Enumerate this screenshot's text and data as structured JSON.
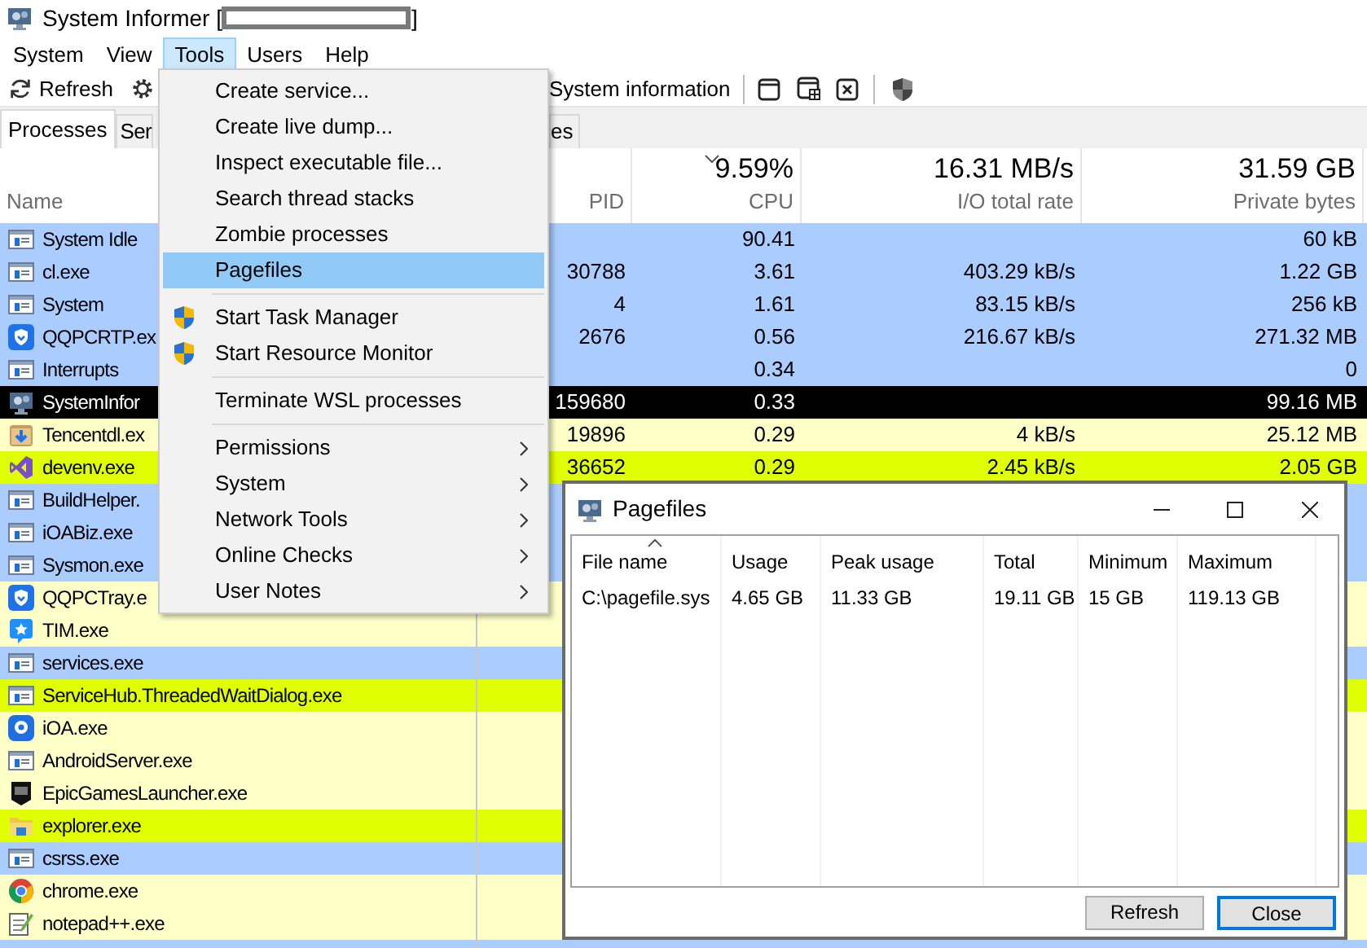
{
  "window": {
    "title_prefix": "System Informer [",
    "title_suffix": "]"
  },
  "menu_bar": [
    {
      "label": "System",
      "selected": false
    },
    {
      "label": "View",
      "selected": false
    },
    {
      "label": "Tools",
      "selected": true
    },
    {
      "label": "Users",
      "selected": false
    },
    {
      "label": "Help",
      "selected": false
    }
  ],
  "toolbar": {
    "refresh": "Refresh",
    "system_information": "System information"
  },
  "tabs": [
    {
      "label": "Processes",
      "selected": true
    },
    {
      "label": "Ser",
      "selected": false
    },
    {
      "label": "es",
      "selected": false
    }
  ],
  "table": {
    "columns": [
      {
        "label": "Name"
      },
      {
        "label": "PID"
      },
      {
        "total": "9.59%",
        "label": "CPU",
        "sorted": true
      },
      {
        "total": "16.31 MB/s",
        "label": "I/O total rate"
      },
      {
        "total": "31.59 GB",
        "label": "Private bytes"
      }
    ],
    "rows": [
      {
        "name": "System Idle",
        "kind": "window",
        "color": "#aaccff",
        "cpu": "90.41",
        "private": "60 kB"
      },
      {
        "name": "cl.exe",
        "kind": "window",
        "color": "#aaccff",
        "pid": "30788",
        "cpu": "3.61",
        "io": "403.29 kB/s",
        "private": "1.22 GB"
      },
      {
        "name": "System",
        "kind": "window",
        "color": "#aaccff",
        "pid": "4",
        "cpu": "1.61",
        "io": "83.15 kB/s",
        "private": "256 kB"
      },
      {
        "name": "QQPCRTP.ex",
        "kind": "shield",
        "color": "#aaccff",
        "pid": "2676",
        "cpu": "0.56",
        "io": "216.67 kB/s",
        "private": "271.32 MB"
      },
      {
        "name": "Interrupts",
        "kind": "window",
        "color": "#aaccff",
        "cpu": "0.34",
        "private": "0"
      },
      {
        "name": "SystemInfor",
        "kind": "monitor",
        "color": "#000000",
        "pid": "159680",
        "cpu": "0.33",
        "private": "99.16 MB"
      },
      {
        "name": "Tencentdl.ex",
        "kind": "box",
        "color": "#ffffc8",
        "pid": "19896",
        "cpu": "0.29",
        "io": "4 kB/s",
        "private": "25.12 MB"
      },
      {
        "name": "devenv.exe",
        "kind": "loop",
        "color": "#e0ff00",
        "pid": "36652",
        "cpu": "0.29",
        "io": "2.45 kB/s",
        "private": "2.05 GB"
      },
      {
        "name": "BuildHelper.",
        "kind": "window",
        "color": "#aaccff"
      },
      {
        "name": "iOABiz.exe",
        "kind": "window",
        "color": "#aaccff"
      },
      {
        "name": "Sysmon.exe",
        "kind": "window",
        "color": "#aaccff"
      },
      {
        "name": "QQPCTray.e",
        "kind": "shield",
        "color": "#ffffc8"
      },
      {
        "name": "TIM.exe",
        "kind": "star",
        "color": "#ffffc8"
      },
      {
        "name": "services.exe",
        "kind": "window",
        "color": "#aaccff"
      },
      {
        "name": "ServiceHub.ThreadedWaitDialog.exe",
        "kind": "window",
        "color": "#e0ff00"
      },
      {
        "name": "iOA.exe",
        "kind": "rounded",
        "color": "#ffffc8"
      },
      {
        "name": "AndroidServer.exe",
        "kind": "window",
        "color": "#ffffc8"
      },
      {
        "name": "EpicGamesLauncher.exe",
        "kind": "badge",
        "color": "#ffffc8"
      },
      {
        "name": "explorer.exe",
        "kind": "folder",
        "color": "#e0ff00"
      },
      {
        "name": "csrss.exe",
        "kind": "window",
        "color": "#aaccff"
      },
      {
        "name": "chrome.exe",
        "kind": "ring",
        "color": "#ffffc8"
      },
      {
        "name": "notepad++.exe",
        "kind": "notepad",
        "color": "#ffffc8"
      },
      {
        "color": "#aaccff"
      }
    ]
  },
  "tools_menu": {
    "items": [
      {
        "kind": "item",
        "label": "Create service...",
        "selected": false
      },
      {
        "kind": "item",
        "label": "Create live dump...",
        "selected": false
      },
      {
        "kind": "item",
        "label": "Inspect executable file...",
        "selected": false
      },
      {
        "kind": "item",
        "label": "Search thread stacks",
        "selected": false
      },
      {
        "kind": "item",
        "label": "Zombie processes",
        "selected": false
      },
      {
        "kind": "item",
        "label": "Pagefiles",
        "selected": true
      },
      {
        "kind": "separator"
      },
      {
        "kind": "elevated",
        "label": "Start Task Manager",
        "selected": false
      },
      {
        "kind": "elevated",
        "label": "Start Resource Monitor",
        "selected": false
      },
      {
        "kind": "separator"
      },
      {
        "kind": "item",
        "label": "Terminate WSL processes",
        "selected": false
      },
      {
        "kind": "separator"
      },
      {
        "kind": "submenu",
        "label": "Permissions",
        "selected": false
      },
      {
        "kind": "submenu",
        "label": "System",
        "selected": false
      },
      {
        "kind": "submenu",
        "label": "Network Tools",
        "selected": false
      },
      {
        "kind": "submenu",
        "label": "Online Checks",
        "selected": false
      },
      {
        "kind": "submenu",
        "label": "User Notes",
        "selected": false
      }
    ]
  },
  "pagefiles_dialog": {
    "title": "Pagefiles",
    "columns": [
      {
        "label": "File name",
        "sorted": true
      },
      {
        "label": "Usage"
      },
      {
        "label": "Peak usage"
      },
      {
        "label": "Total"
      },
      {
        "label": "Minimum"
      },
      {
        "label": "Maximum"
      }
    ],
    "rows": [
      [
        "C:\\pagefile.sys",
        "4.65 GB",
        "11.33 GB",
        "19.11 GB",
        "15 GB",
        "119.13 GB"
      ]
    ],
    "buttons": [
      {
        "label": "Refresh",
        "default": false
      },
      {
        "label": "Close",
        "default": true
      }
    ]
  }
}
